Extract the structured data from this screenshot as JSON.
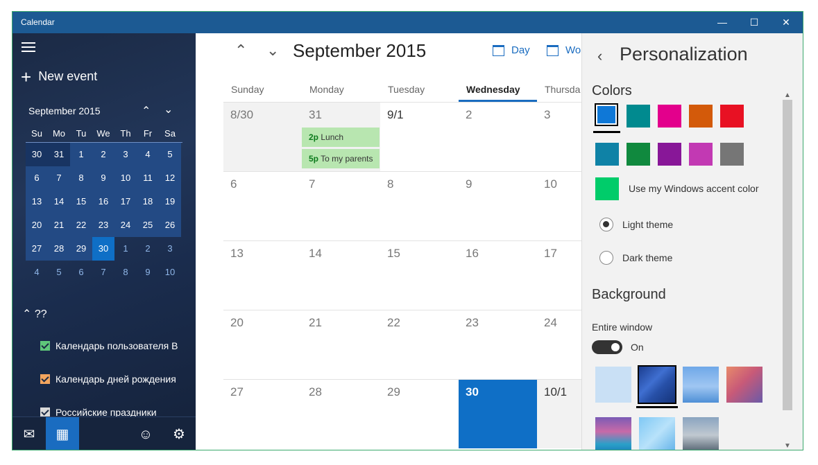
{
  "window": {
    "title": "Calendar",
    "buttons": [
      "—",
      "☐",
      "✕"
    ]
  },
  "sidebar": {
    "new_event_label": "New event",
    "mini_calendar": {
      "month_label": "September 2015",
      "weekdays": [
        "Su",
        "Mo",
        "Tu",
        "We",
        "Th",
        "Fr",
        "Sa"
      ],
      "weeks": [
        [
          "30",
          "31",
          "1",
          "2",
          "3",
          "4",
          "5"
        ],
        [
          "6",
          "7",
          "8",
          "9",
          "10",
          "11",
          "12"
        ],
        [
          "13",
          "14",
          "15",
          "16",
          "17",
          "18",
          "19"
        ],
        [
          "20",
          "21",
          "22",
          "23",
          "24",
          "25",
          "26"
        ],
        [
          "27",
          "28",
          "29",
          "30",
          "1",
          "2",
          "3"
        ],
        [
          "4",
          "5",
          "6",
          "7",
          "8",
          "9",
          "10"
        ]
      ],
      "selected_day": "30"
    },
    "group_label": "??",
    "calendars": [
      {
        "label": "Календарь пользователя В",
        "color": "#5fc77a"
      },
      {
        "label": "Календарь дней рождения",
        "color": "#f3a55e"
      },
      {
        "label": "Российские праздники",
        "color": "#d9d9d9"
      }
    ],
    "bottom_icons": [
      "mail-icon",
      "calendar-icon",
      "smiley-icon",
      "gear-icon"
    ]
  },
  "main": {
    "month_title": "September 2015",
    "views": [
      "Day",
      "Wor"
    ],
    "day_headers": [
      "Sunday",
      "Monday",
      "Tuesday",
      "Wednesday",
      "Thursda"
    ],
    "weeks": [
      [
        "8/30",
        "31",
        "9/1",
        "2",
        "3"
      ],
      [
        "6",
        "7",
        "8",
        "9",
        "10"
      ],
      [
        "13",
        "14",
        "15",
        "16",
        "17"
      ],
      [
        "20",
        "21",
        "22",
        "23",
        "24"
      ],
      [
        "27",
        "28",
        "29",
        "30",
        "10/1"
      ]
    ],
    "events": [
      {
        "time": "2p",
        "title": "Lunch"
      },
      {
        "time": "5p",
        "title": "To my parents"
      }
    ]
  },
  "panel": {
    "title": "Personalization",
    "colors_title": "Colors",
    "colors": [
      "#0f78d7",
      "#018a8f",
      "#e3008c",
      "#d35a0a",
      "#e81123",
      "#0f82a6",
      "#10893e",
      "#881798",
      "#c239b3",
      "#767676"
    ],
    "accent_color": "#00cc6a",
    "accent_label": "Use my Windows accent color",
    "themes": [
      "Light theme",
      "Dark theme"
    ],
    "background_title": "Background",
    "entire_window_label": "Entire window",
    "toggle_label": "On"
  }
}
